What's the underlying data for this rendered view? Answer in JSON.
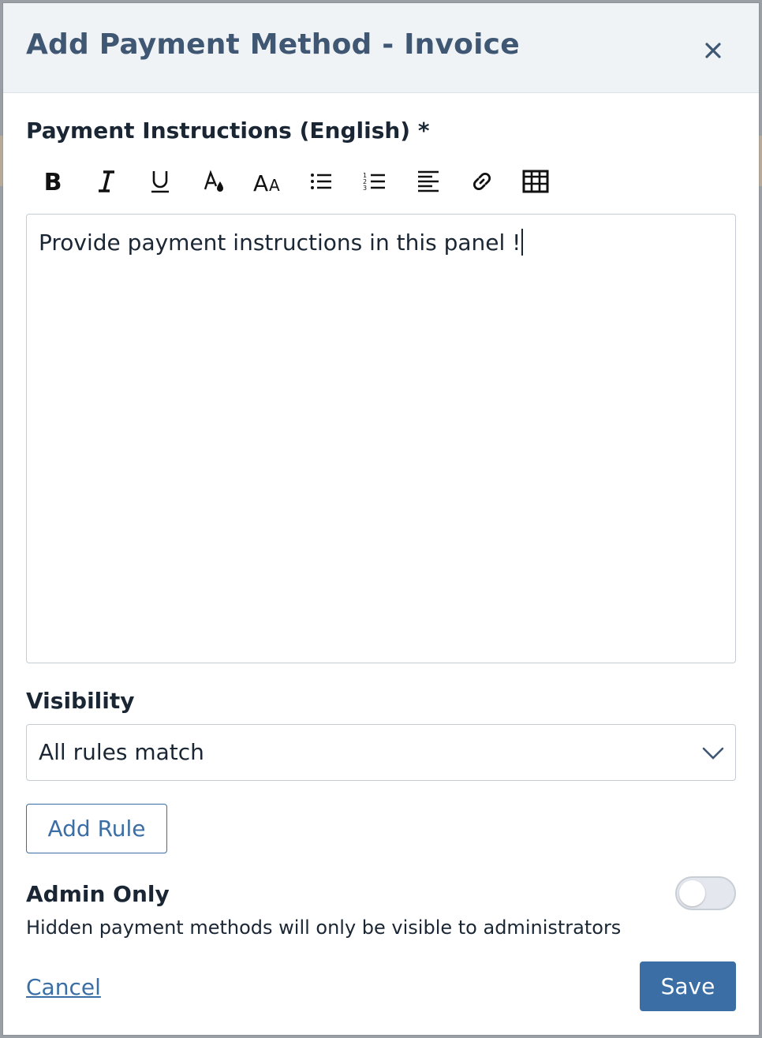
{
  "modal": {
    "title": "Add Payment Method - Invoice",
    "close_icon": "close-icon"
  },
  "instructions": {
    "label": "Payment Instructions (English) *",
    "content": "Provide payment instructions in this panel !"
  },
  "toolbar": {
    "items": [
      {
        "icon": "bold-icon",
        "label": "Bold"
      },
      {
        "icon": "italic-icon",
        "label": "Italic"
      },
      {
        "icon": "underline-icon",
        "label": "Underline"
      },
      {
        "icon": "text-color-icon",
        "label": "Text color"
      },
      {
        "icon": "font-size-icon",
        "label": "Font size"
      },
      {
        "icon": "bullet-list-icon",
        "label": "Bulleted list"
      },
      {
        "icon": "numbered-list-icon",
        "label": "Numbered list"
      },
      {
        "icon": "align-left-icon",
        "label": "Align"
      },
      {
        "icon": "link-icon",
        "label": "Link"
      },
      {
        "icon": "table-icon",
        "label": "Table"
      }
    ]
  },
  "visibility": {
    "label": "Visibility",
    "selected": "All rules match",
    "add_rule_label": "Add Rule"
  },
  "admin_only": {
    "label": "Admin Only",
    "description": "Hidden payment methods will only be visible to administrators",
    "enabled": false
  },
  "footer": {
    "cancel_label": "Cancel",
    "save_label": "Save"
  },
  "colors": {
    "accent": "#3a6ea5",
    "title": "#3f5773",
    "header_bg": "#f0f3f6",
    "text": "#1a2633",
    "border": "#c6ccd3"
  }
}
